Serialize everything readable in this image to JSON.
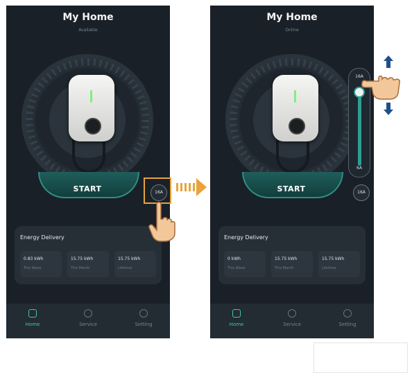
{
  "colors": {
    "background": "#1a2027",
    "accent": "#3fc7b7",
    "highlight": "#e8a33d"
  },
  "left_screen": {
    "title": "My Home",
    "subtitle": "Available",
    "start_label": "START",
    "amp_label": "16A",
    "energy": {
      "title": "Energy Delivery",
      "cells": [
        {
          "value": "0.83 kWh",
          "label": "This Week"
        },
        {
          "value": "15.75 kWh",
          "label": "This Month"
        },
        {
          "value": "15.75 kWh",
          "label": "Lifetime"
        }
      ]
    },
    "nav": [
      {
        "label": "Home",
        "icon": "home-icon"
      },
      {
        "label": "Service",
        "icon": "service-icon"
      },
      {
        "label": "Setting",
        "icon": "setting-icon"
      }
    ]
  },
  "right_screen": {
    "title": "My Home",
    "subtitle": "Online",
    "start_label": "START",
    "amp_label": "16A",
    "slider": {
      "max_label": "16A",
      "min_label": "6A",
      "level": 1.0
    },
    "energy": {
      "title": "Energy Delivery",
      "cells": [
        {
          "value": "0 kWh",
          "label": "This Week"
        },
        {
          "value": "15.75 kWh",
          "label": "This Month"
        },
        {
          "value": "15.75 kWh",
          "label": "Lifetime"
        }
      ]
    },
    "nav": [
      {
        "label": "Home",
        "icon": "home-icon"
      },
      {
        "label": "Service",
        "icon": "service-icon"
      },
      {
        "label": "Setting",
        "icon": "setting-icon"
      }
    ]
  }
}
